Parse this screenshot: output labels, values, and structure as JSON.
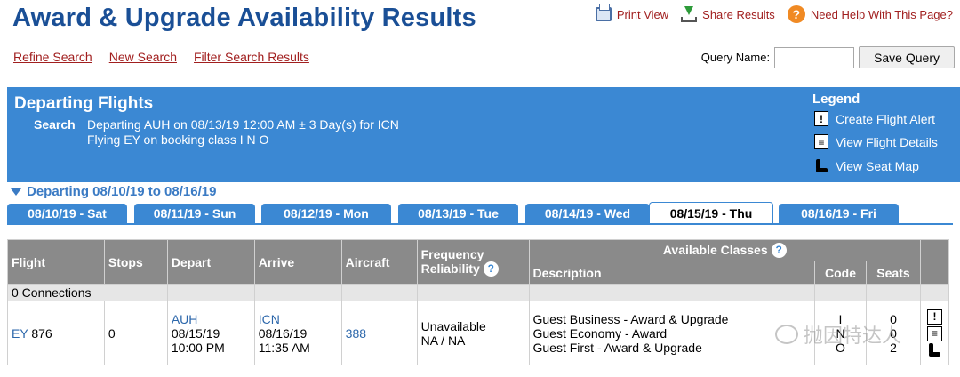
{
  "page": {
    "title": "Award & Upgrade Availability Results"
  },
  "top_links": {
    "print": "Print View",
    "share": "Share Results",
    "help": "Need Help With This Page?"
  },
  "sub_links": {
    "refine": "Refine Search",
    "new": "New Search",
    "filter": "Filter Search Results"
  },
  "query": {
    "label": "Query Name:",
    "value": "",
    "save_button": "Save Query"
  },
  "panel": {
    "title": "Departing Flights",
    "search_label": "Search",
    "search_line1": "Departing AUH on 08/13/19 12:00 AM ± 3 Day(s) for ICN",
    "search_line2": "Flying EY on booking class I N O",
    "legend_title": "Legend",
    "legend": [
      "Create Flight Alert",
      "View Flight Details",
      "View Seat Map"
    ]
  },
  "range": "Departing 08/10/19 to 08/16/19",
  "tabs": [
    "08/10/19 - Sat",
    "08/11/19 - Sun",
    "08/12/19 - Mon",
    "08/13/19 - Tue",
    "08/14/19 - Wed",
    "08/15/19 - Thu",
    "08/16/19 - Fri"
  ],
  "active_tab": "08/15/19 - Thu",
  "table": {
    "headers": {
      "flight": "Flight",
      "stops": "Stops",
      "depart": "Depart",
      "arrive": "Arrive",
      "aircraft": "Aircraft",
      "freq1": "Frequency",
      "freq2": "Reliability",
      "avail": "Available Classes",
      "desc": "Description",
      "code": "Code",
      "seats": "Seats"
    },
    "connections": "0 Connections",
    "row": {
      "airline": "EY",
      "flight_no": "876",
      "stops": "0",
      "dep_airport": "AUH",
      "dep_date": "08/15/19",
      "dep_time": "10:00 PM",
      "arr_airport": "ICN",
      "arr_date": "08/16/19",
      "arr_time": "11:35 AM",
      "aircraft": "388",
      "freq1": "Unavailable",
      "freq2": "NA / NA",
      "classes": [
        {
          "desc": "Guest Business - Award & Upgrade",
          "code": "I",
          "seats": "0"
        },
        {
          "desc": "Guest Economy - Award",
          "code": "N",
          "seats": "0"
        },
        {
          "desc": "Guest First - Award & Upgrade",
          "code": "O",
          "seats": "2"
        }
      ]
    }
  },
  "watermark": "抛因特达人"
}
